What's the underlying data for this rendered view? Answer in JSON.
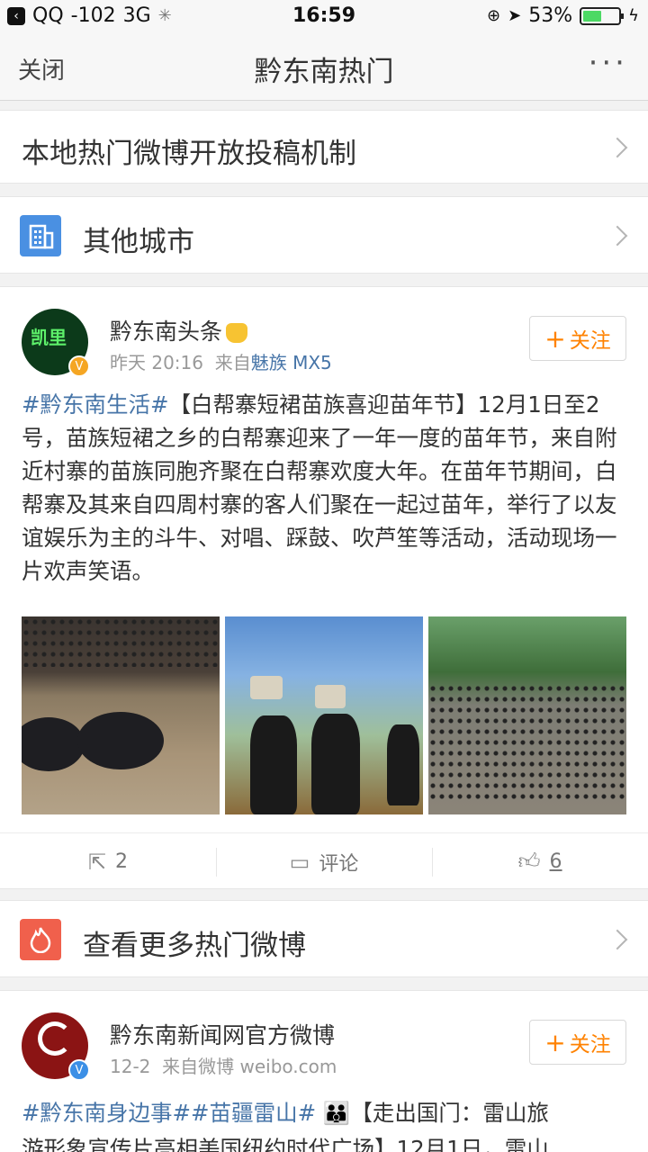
{
  "status_bar": {
    "carrier": "QQ",
    "signal": "-102",
    "network": "3G",
    "time": "16:59",
    "battery": "53%",
    "battery_level": 0.53
  },
  "nav": {
    "close_label": "关闭",
    "title": "黔东南热门",
    "more_label": "···"
  },
  "rows": {
    "submission": "本地热门微博开放投稿机制",
    "other_cities": "其他城市",
    "more_hot": "查看更多热门微博"
  },
  "post1": {
    "avatar_text": "凯里",
    "username": "黔东南头条",
    "time": "昨天 20:16",
    "source_prefix": "来自",
    "source": "魅族 MX5",
    "follow_label": "关注",
    "tag": "#黔东南生活#",
    "text": "【白帮寨短裙苗族喜迎苗年节】12月1日至2号，苗族短裙之乡的白帮寨迎来了一年一度的苗年节，来自附近村寨的苗族同胞齐聚在白帮寨欢度大年。在苗年节期间，白帮寨及其来自四周村寨的客人们聚在一起过苗年，举行了以友谊娱乐为主的斗牛、对唱、踩鼓、吹芦笙等活动，活动现场一片欢声笑语。",
    "reposts": "2",
    "comments_label": "评论",
    "likes": "6"
  },
  "post2": {
    "username": "黔东南新闻网官方微博",
    "time": "12-2",
    "source_prefix": "来自微博",
    "source": "weibo.com",
    "follow_label": "关注",
    "tags": "#黔东南身边事##苗疆雷山#",
    "text_line1": "【走出国门：雷山旅",
    "text_line2": "游形象宣传片亮相美国纽约时代广场】12月1日，雷山"
  },
  "colors": {
    "link_blue": "#4775a8",
    "follow_orange": "#ff8200",
    "city_icon_blue": "#4a90e2",
    "hot_icon_red": "#f0604c"
  }
}
